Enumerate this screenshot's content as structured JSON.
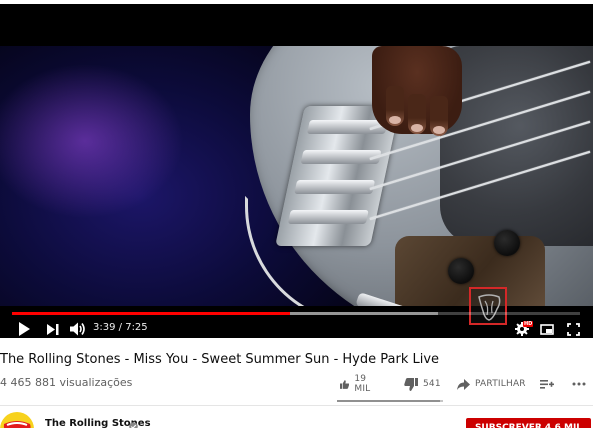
{
  "player": {
    "current_time": "3:39",
    "duration": "7:25",
    "time_separator": " / ",
    "progress": 0.49,
    "buffered": 0.75,
    "hd_badge": "HD",
    "watermark": "rolling-stones-tongue-logo"
  },
  "video": {
    "title": "The Rolling Stones - Miss You - Sweet Summer Sun - Hyde Park Live",
    "views": "4 465 881 visualizações"
  },
  "actions": {
    "like_count": "19 MIL",
    "dislike_count": "541",
    "share_label": "PARTILHAR",
    "like_ratio": 0.97
  },
  "channel": {
    "name": "The Rolling Stones",
    "verified": true
  },
  "subscribe": {
    "label": "SUBSCREVER 4,6 MIL"
  },
  "colors": {
    "accent_red": "#ff0000",
    "subscribe_bg": "#cc0000",
    "text_primary": "#0d0d0d",
    "text_secondary": "#606060"
  },
  "icons": [
    "play-icon",
    "next-icon",
    "volume-icon",
    "settings-icon",
    "miniplayer-icon",
    "theater-icon",
    "fullscreen-icon",
    "like-icon",
    "dislike-icon",
    "share-icon",
    "add-to-playlist-icon",
    "more-icon",
    "verified-icon"
  ]
}
